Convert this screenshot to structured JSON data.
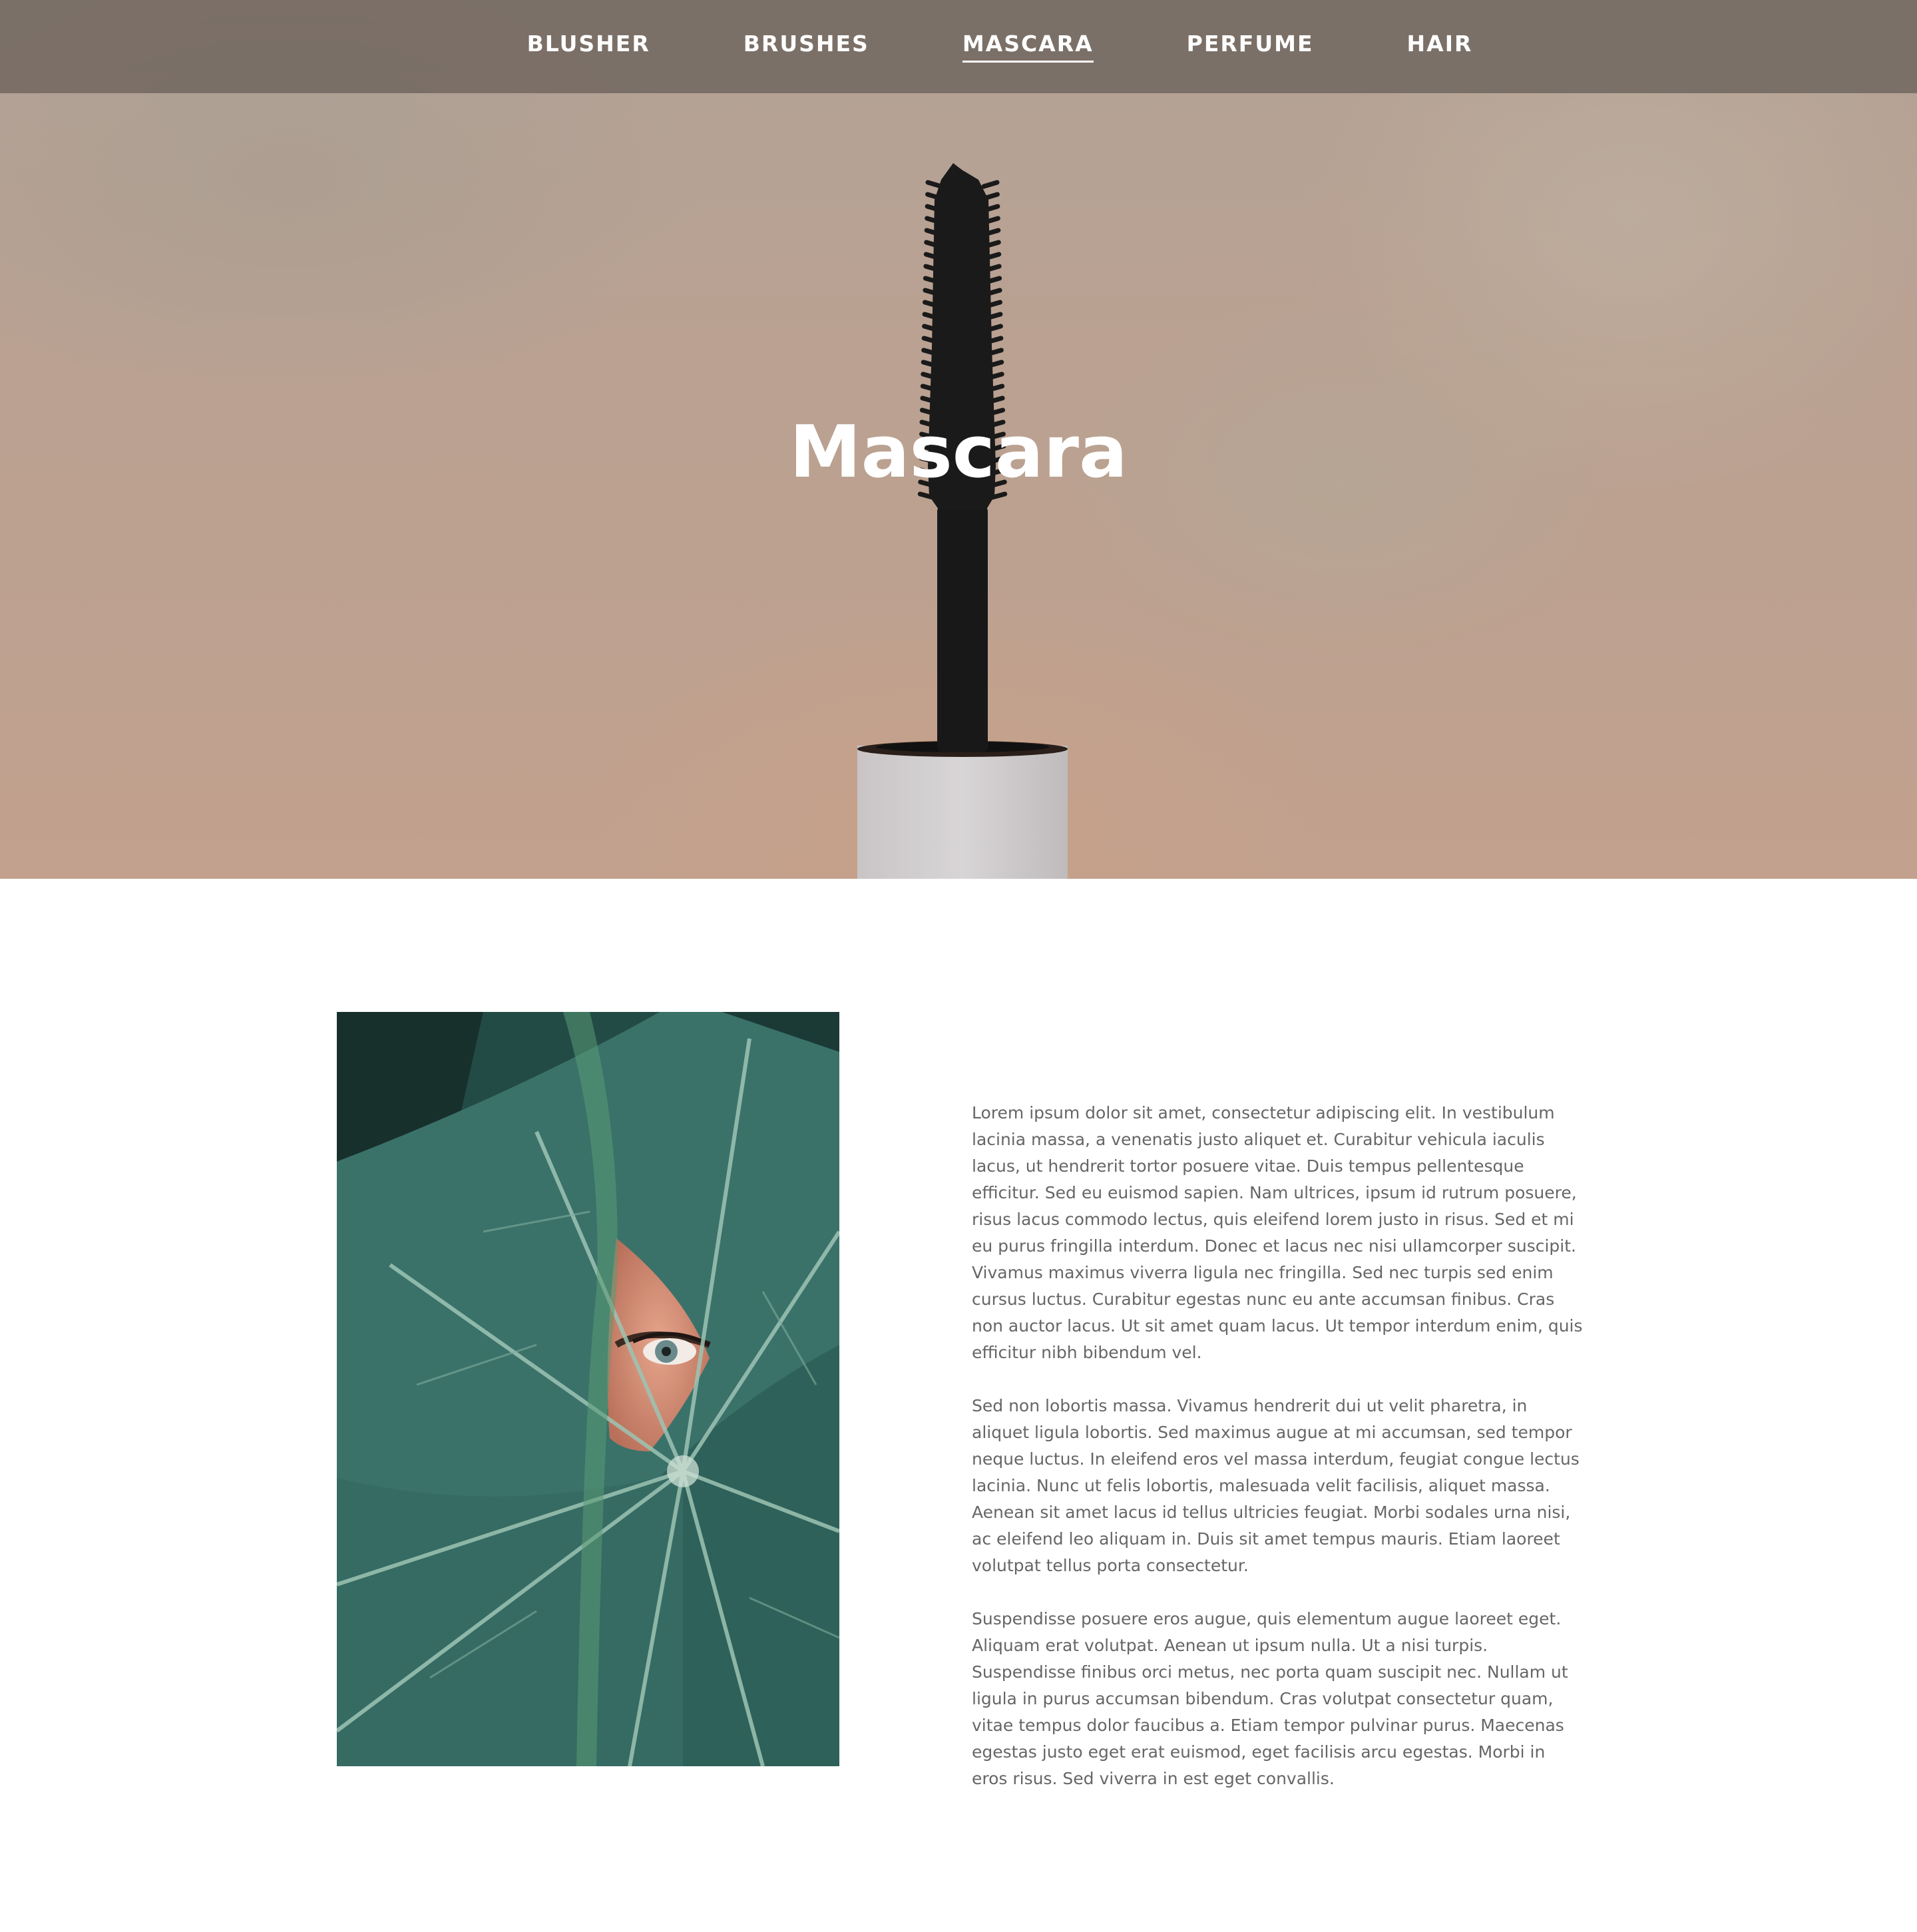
{
  "nav": {
    "items": [
      {
        "label": "BLUSHER",
        "active": false
      },
      {
        "label": "BRUSHES",
        "active": false
      },
      {
        "label": "MASCARA",
        "active": true
      },
      {
        "label": "PERFUME",
        "active": false
      },
      {
        "label": "HAIR",
        "active": false
      }
    ]
  },
  "hero": {
    "title": "Mascara",
    "image": "mascara-wand-photo"
  },
  "feature_image": "eye-behind-leaf-photo",
  "content": {
    "paragraphs": [
      "Lorem ipsum dolor sit amet, consectetur adipiscing elit. In vestibulum lacinia massa, a venenatis justo aliquet et. Curabitur vehicula iaculis lacus, ut hendrerit tortor posuere vitae. Duis tempus pellentesque efficitur. Sed eu euismod sapien. Nam ultrices, ipsum id rutrum posuere, risus lacus commodo lectus, quis eleifend lorem justo in risus. Sed et mi eu purus fringilla interdum. Donec et lacus nec nisi ullamcorper suscipit. Vivamus maximus viverra ligula nec fringilla. Sed nec turpis sed enim cursus luctus. Curabitur egestas nunc eu ante accumsan finibus. Cras non auctor lacus. Ut sit amet quam lacus. Ut tempor interdum enim, quis efficitur nibh bibendum vel.",
      "Sed non lobortis massa. Vivamus hendrerit dui ut velit pharetra, in aliquet ligula lobortis. Sed maximus augue at mi accumsan, sed tempor neque luctus. In eleifend eros vel massa interdum, feugiat congue lectus lacinia. Nunc ut felis lobortis, malesuada velit facilisis, aliquet massa. Aenean sit amet lacus id tellus ultricies feugiat. Morbi sodales urna nisi, ac eleifend leo aliquam in. Duis sit amet tempus mauris. Etiam laoreet volutpat tellus porta consectetur.",
      "Suspendisse posuere eros augue, quis elementum augue laoreet eget. Aliquam erat volutpat. Aenean ut ipsum nulla. Ut a nisi turpis. Suspendisse finibus orci metus, nec porta quam suscipit nec. Nullam ut ligula in purus accumsan bibendum. Cras volutpat consectetur quam, vitae tempus dolor faucibus a. Etiam tempor pulvinar purus. Maecenas egestas justo eget erat euismod, eget facilisis arcu egestas. Morbi in eros risus. Sed viverra in est eget convallis."
    ]
  },
  "colors": {
    "nav_bg": "#766c64",
    "nav_text": "#ffffff",
    "body_text": "#666666",
    "hero_title": "#ffffff"
  }
}
